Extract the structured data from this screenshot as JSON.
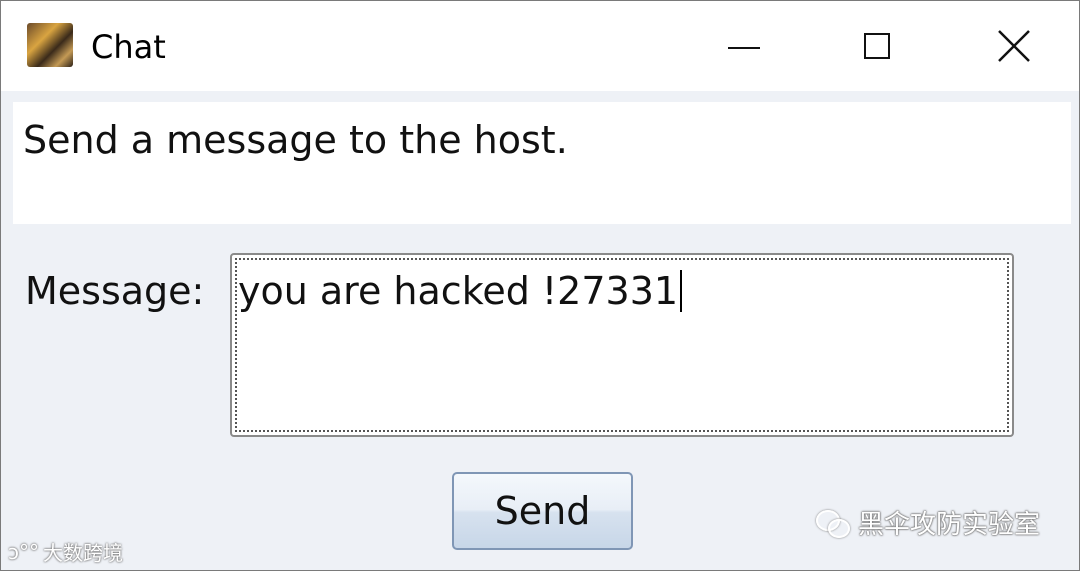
{
  "window": {
    "title": "Chat",
    "controls": {
      "minimize": "minimize",
      "maximize": "maximize",
      "close": "close"
    }
  },
  "info": {
    "text": "Send a message to the host."
  },
  "form": {
    "message_label": "Message:",
    "message_value": "you are hacked !27331",
    "send_label": "Send"
  },
  "watermarks": {
    "left": "大数跨境",
    "right": "黑伞攻防实验室"
  },
  "icons": {
    "app": "app-icon",
    "minimize": "minimize-icon",
    "maximize": "maximize-icon",
    "close": "close-icon",
    "wechat": "wechat-icon"
  }
}
